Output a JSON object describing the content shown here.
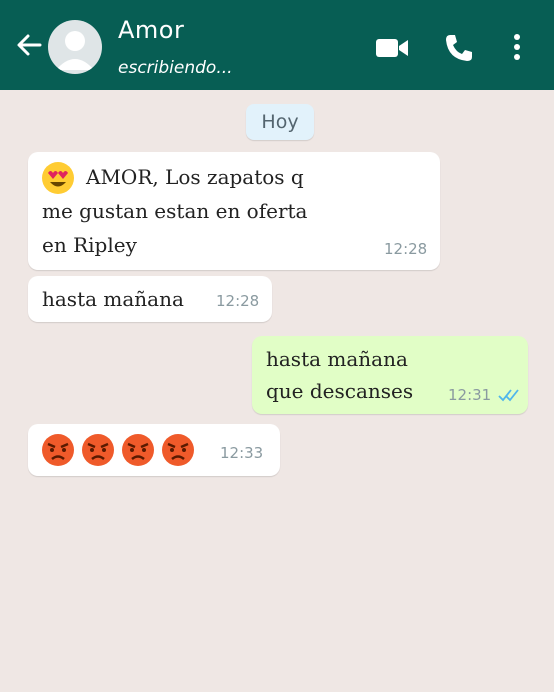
{
  "header": {
    "contact_name": "Amor",
    "status": "escribiendo...",
    "icons": [
      "back-arrow-icon",
      "avatar",
      "video-call-icon",
      "phone-icon",
      "more-options-icon"
    ]
  },
  "chat": {
    "date_label": "Hoy",
    "messages": [
      {
        "direction": "incoming",
        "emoji": "heart-eyes-emoji",
        "text_line1": "AMOR, Los zapatos q",
        "text_line2": "me gustan estan en oferta",
        "text_line3": "en Ripley",
        "time": "12:28"
      },
      {
        "direction": "incoming",
        "text": "hasta mañana",
        "time": "12:28"
      },
      {
        "direction": "outgoing",
        "text_line1": "hasta mañana",
        "text_line2": "que descanses",
        "time": "12:31",
        "status": "read-ticks-icon"
      },
      {
        "direction": "incoming",
        "emojis": [
          "angry-face-emoji",
          "angry-face-emoji",
          "angry-face-emoji",
          "angry-face-emoji"
        ],
        "time": "12:33"
      }
    ]
  },
  "colors": {
    "header": "#075e54",
    "incoming_bubble": "#ffffff",
    "outgoing_bubble": "#e1fec6",
    "background": "#efe7e4",
    "read_ticks": "#4fb6ec"
  }
}
